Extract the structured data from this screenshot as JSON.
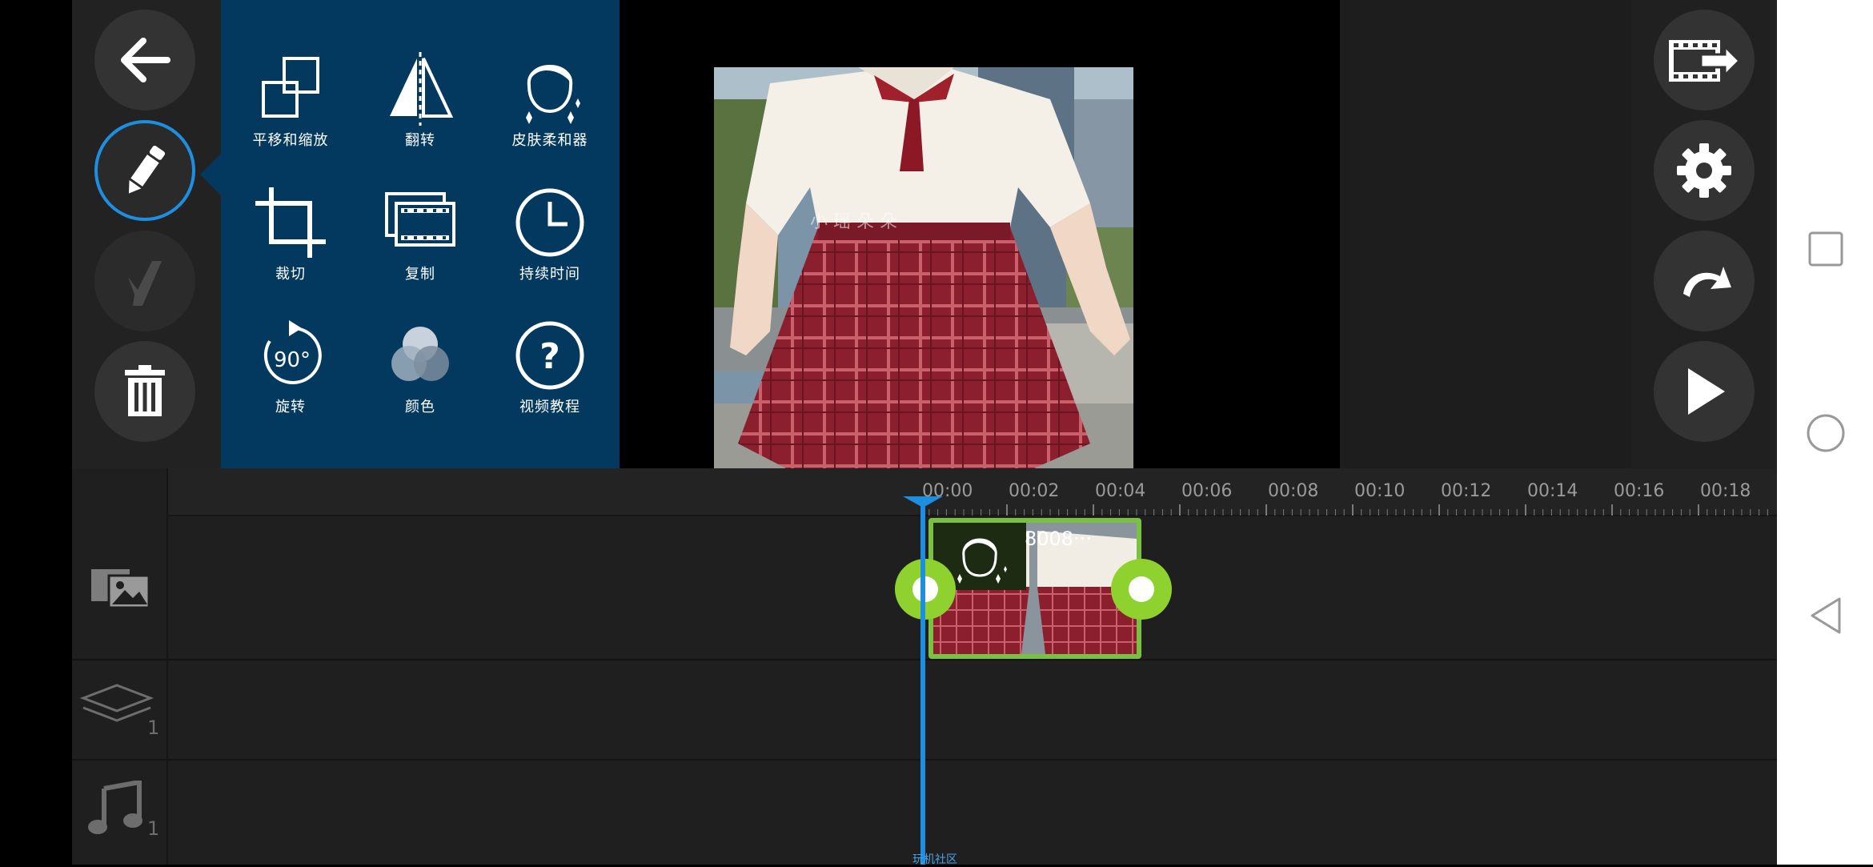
{
  "tools": [
    {
      "label": "平移和缩放",
      "icon": "pan-zoom-icon"
    },
    {
      "label": "翻转",
      "icon": "flip-icon"
    },
    {
      "label": "皮肤柔和器",
      "icon": "skin-smoother-icon"
    },
    {
      "label": "裁切",
      "icon": "crop-icon"
    },
    {
      "label": "复制",
      "icon": "duplicate-icon"
    },
    {
      "label": "持续时间",
      "icon": "duration-clock-icon"
    },
    {
      "label": "旋转",
      "icon": "rotate-90-icon",
      "badge": "90°"
    },
    {
      "label": "颜色",
      "icon": "color-icon"
    },
    {
      "label": "视频教程",
      "icon": "video-tutorial-icon",
      "badge": "?"
    }
  ],
  "left_rail": [
    "back-arrow-icon",
    "pencil-edit-icon",
    "magic-wand-icon",
    "trash-icon"
  ],
  "right_rail": [
    "export-video-icon",
    "settings-gear-icon",
    "undo-icon",
    "play-icon"
  ],
  "preview": {
    "watermark": "小 瑶 朵 朵"
  },
  "timeline": {
    "ticks": [
      "00:00",
      "00:02",
      "00:04",
      "00:06",
      "00:08",
      "00:10",
      "00:12",
      "00:14",
      "00:16",
      "00:18"
    ],
    "clip_label": "8008···",
    "layer_count": "1",
    "audio_count": "1",
    "bottom_watermark": "玩机社区"
  },
  "colors": {
    "accent": "#1e8fe0",
    "panel": "#04395f",
    "clip": "#7ac143"
  }
}
